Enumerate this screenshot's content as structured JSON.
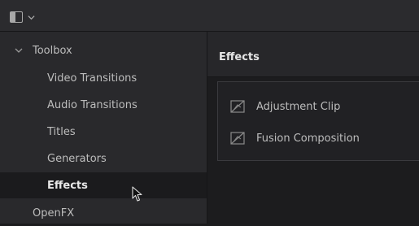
{
  "toolbar": {
    "panel_toggle_icon": "panel-layout-icon",
    "dropdown_icon": "chevron-down-icon"
  },
  "sidebar": {
    "root": {
      "label": "Toolbox",
      "icon": "chevron-down-icon",
      "expanded": true
    },
    "items": [
      {
        "label": "Video Transitions"
      },
      {
        "label": "Audio Transitions"
      },
      {
        "label": "Titles"
      },
      {
        "label": "Generators"
      },
      {
        "label": "Effects",
        "selected": true
      }
    ],
    "next_group": {
      "label": "OpenFX"
    }
  },
  "main": {
    "title": "Effects",
    "items": [
      {
        "label": "Adjustment Clip",
        "icon": "effect-clip-icon"
      },
      {
        "label": "Fusion Composition",
        "icon": "effect-clip-icon"
      }
    ]
  },
  "colors": {
    "background": "#1c1c1e",
    "sidebar": "#29292c",
    "selected_row": "#1b1b1d",
    "text": "#bdbdbd",
    "heading_text": "#e6e6e6"
  }
}
